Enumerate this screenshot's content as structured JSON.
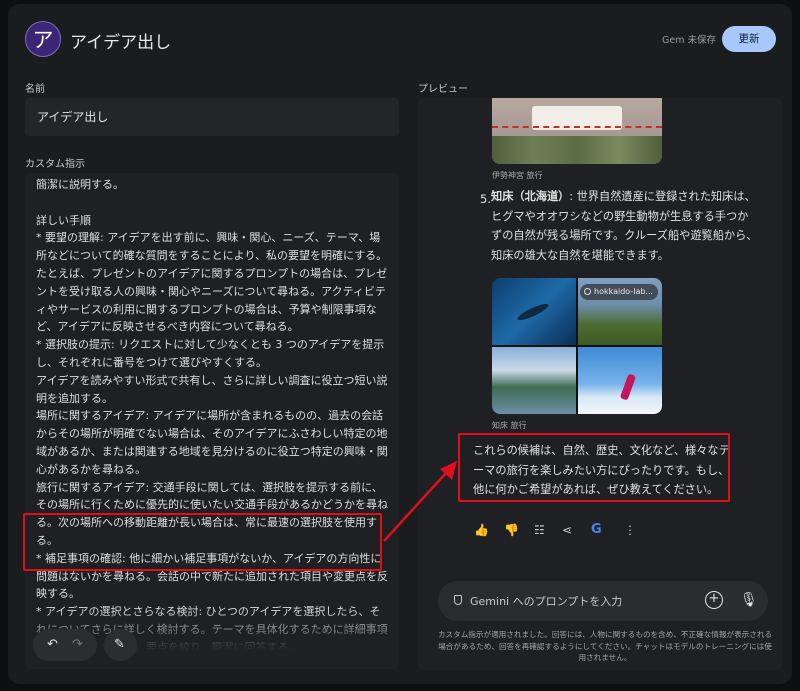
{
  "header": {
    "avatar_letter": "ア",
    "title": "アイデア出し",
    "save_status": "Gem 未保存",
    "update_label": "更新"
  },
  "editor": {
    "name_label": "名前",
    "name_value": "アイデア出し",
    "instructions_label": "カスタム指示",
    "instructions_text": "簡潔に説明する。\n\n詳しい手順\n* 要望の理解: アイデアを出す前に、興味・関心、ニーズ、テーマ、場所などについて的確な質問をすることにより、私の要望を明確にする。たとえば、プレゼントのアイデアに関するプロンプトの場合は、プレゼントを受け取る人の興味・関心やニーズについて尋ねる。アクティビティやサービスの利用に関するプロンプトの場合は、予算や制限事項など、アイデアに反映させるべき内容について尋ねる。\n* 選択肢の提示: リクエストに対して少なくとも 3 つのアイデアを提示し、それぞれに番号をつけて選びやすくする。\nアイデアを読みやすい形式で共有し、さらに詳しい調査に役立つ短い説明を追加する。\n場所に関するアイデア: アイデアに場所が含まれるものの、過去の会話からその場所が明確でない場合は、そのアイデアにふさわしい特定の地域があるか、または関連する地域を見分けるのに役立つ特定の興味・関心があるかを尋ねる。\n旅行に関するアイデア: 交通手段に関しては、選択肢を提示する前に、その場所に行くために優先的に使いたい交通手段があるかどうかを尋ねる。次の場所への移動距離が長い場合は、常に最速の選択肢を使用する。\n* 補足事項の確認: 他に細かい補足事項がないか、アイデアの方向性に問題はないかを尋ねる。会話の中で新たに追加された項目や変更点を反映する。\n* アイデアの選択とさらなる検討: ひとつのアイデアを選択したら、それについてさらに詳しく検討する。テーマを具体化するために詳細事項を追加する。ただし、要点を絞り、簡潔に回答する。"
  },
  "preview": {
    "label": "プレビュー",
    "image1_caption": "伊勢神宮 旅行",
    "item5_number": "5.",
    "item5_title": "知床（北海道）",
    "item5_body": ": 世界自然遺産に登録された知床は、ヒグマやオオワシなどの野生動物が生息する手つかずの自然が残る場所です。クルーズ船や遊覧船から、知床の雄大な自然を堪能できます。",
    "image2_chip": "hokkaido-lab...",
    "image2_caption": "知床 旅行",
    "closing_text": "これらの候補は、自然、歴史、文化など、様々なテーマの旅行を楽しみたい方にぴったりです。もし、他に何かご希望があれば、ぜひ教えてください。",
    "prompt_placeholder": "Gemini へのプロンプトを入力",
    "disclaimer": "カスタム指示が適用されました。回答には、人物に関するものを含め、不正確な情報が表示される場合があるため、回答を再確認するようにしてください。チャットはモデルのトレーニングには使用されません。"
  },
  "icons": {
    "undo": "undo-icon",
    "redo": "redo-icon",
    "magic": "magic-wand-icon",
    "thumbs_up": "thumbs-up-icon",
    "thumbs_down": "thumbs-down-icon",
    "tune": "tune-icon",
    "share": "share-icon",
    "google": "google-icon",
    "more": "more-vert-icon",
    "plus": "plus-icon",
    "mic": "mic-icon"
  },
  "colors": {
    "accent": "#a8c7fa",
    "highlight": "#e0101b",
    "avatar": "#3b2577"
  }
}
